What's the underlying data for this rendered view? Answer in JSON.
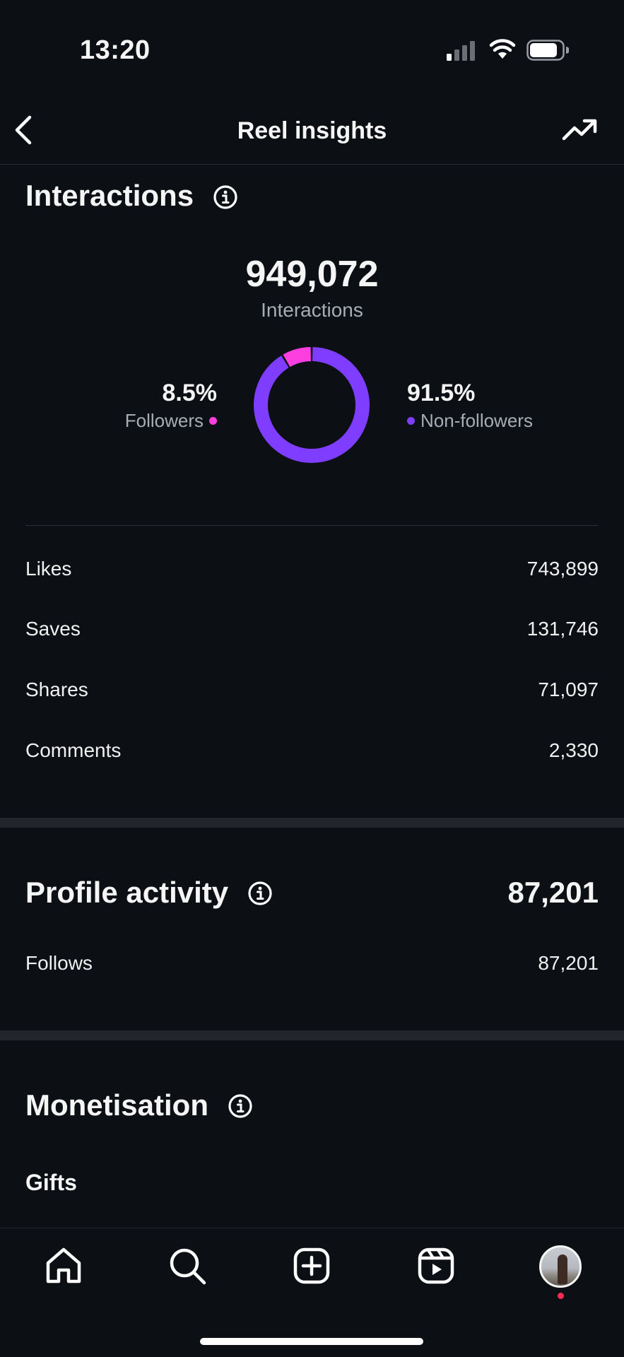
{
  "status_bar": {
    "time": "13:20"
  },
  "header": {
    "title": "Reel insights"
  },
  "interactions": {
    "title": "Interactions",
    "total": "949,072",
    "total_label": "Interactions",
    "followers": {
      "pct": "8.5%",
      "label": "Followers",
      "color": "#ff3ee0",
      "fraction": 0.085
    },
    "non_followers": {
      "pct": "91.5%",
      "label": "Non-followers",
      "color": "#7f3dff",
      "fraction": 0.915
    },
    "rows": [
      {
        "label": "Likes",
        "value": "743,899"
      },
      {
        "label": "Saves",
        "value": "131,746"
      },
      {
        "label": "Shares",
        "value": "71,097"
      },
      {
        "label": "Comments",
        "value": "2,330"
      }
    ]
  },
  "profile_activity": {
    "title": "Profile activity",
    "total": "87,201",
    "rows": [
      {
        "label": "Follows",
        "value": "87,201"
      }
    ]
  },
  "monetisation": {
    "title": "Monetisation",
    "gifts_label": "Gifts"
  },
  "nav": {
    "items": [
      "home-icon",
      "search-icon",
      "create-icon",
      "reels-icon",
      "profile-avatar"
    ]
  }
}
